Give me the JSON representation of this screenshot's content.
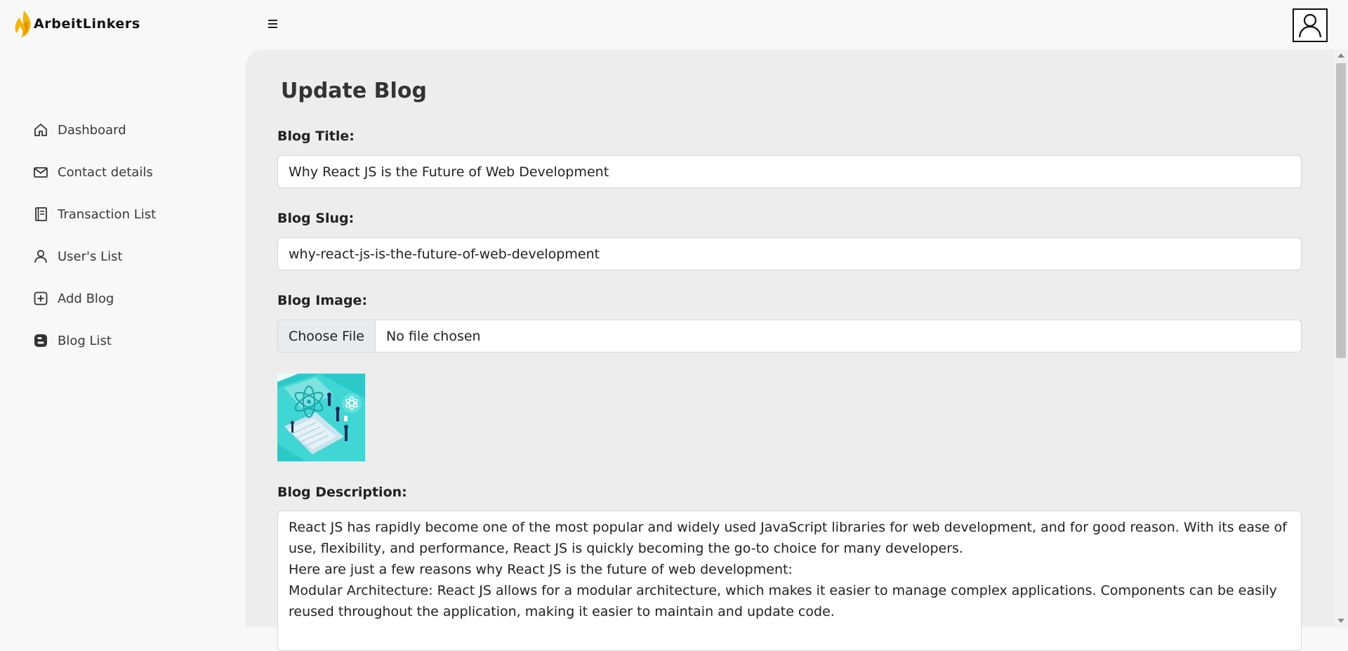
{
  "brand": {
    "name": "ArbeitLinkers",
    "flame_color": "#f5b400"
  },
  "header": {
    "menu_icon": "hamburger-icon",
    "avatar_icon": "user-icon"
  },
  "sidebar": {
    "items": [
      {
        "label": "Dashboard",
        "icon": "home-icon"
      },
      {
        "label": "Contact details",
        "icon": "envelope-icon"
      },
      {
        "label": "Transaction List",
        "icon": "receipt-icon"
      },
      {
        "label": "User's List",
        "icon": "person-icon"
      },
      {
        "label": "Add Blog",
        "icon": "plus-square-icon"
      },
      {
        "label": "Blog List",
        "icon": "blogger-icon"
      }
    ]
  },
  "form": {
    "heading": "Update Blog",
    "title_label": "Blog Title:",
    "title_value": "Why React JS is the Future of Web Development",
    "slug_label": "Blog Slug:",
    "slug_value": "why-react-js-is-the-future-of-web-development",
    "image_label": "Blog Image:",
    "file_button": "Choose File",
    "file_status": "No file chosen",
    "description_label": "Blog Description:",
    "description_lines": [
      "React JS has rapidly become one of the most popular and widely used JavaScript libraries for web development, and for good reason. With its ease of use, flexibility, and performance, React JS is quickly becoming the go-to choice for many developers.",
      "Here are just a few reasons why React JS is the future of web development:",
      "Modular Architecture: React JS allows for a modular architecture, which makes it easier to manage complex applications. Components can be easily reused throughout the application, making it easier to maintain and update code."
    ]
  },
  "colors": {
    "panel_bg": "#ededed",
    "page_bg": "#f8f8f8",
    "accent": "#f5b400"
  }
}
